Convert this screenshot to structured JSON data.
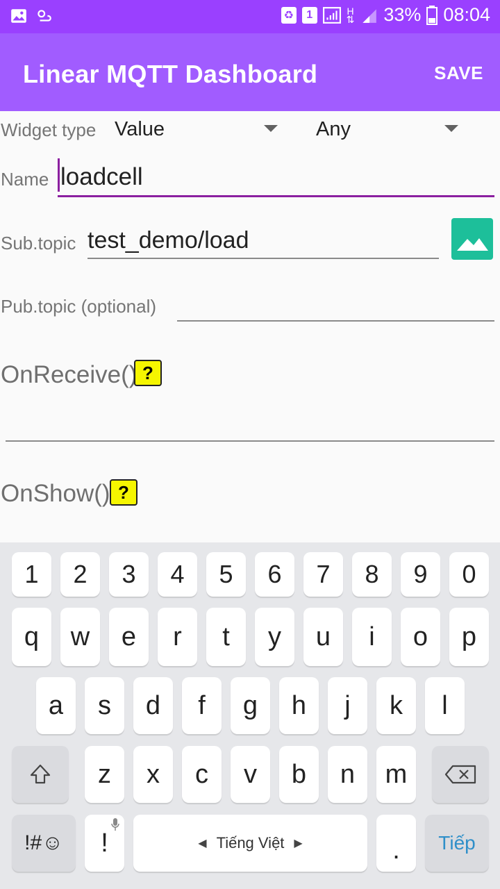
{
  "status_bar": {
    "battery_percent": "33%",
    "time": "08:04",
    "sim_slot": "1",
    "net_type": "H",
    "icons": [
      "image-icon",
      "weather-icon",
      "recycle-icon",
      "sim-icon",
      "signal-icon",
      "data-arrows-icon",
      "signal-icon",
      "battery-icon"
    ]
  },
  "app_bar": {
    "title": "Linear MQTT Dashboard",
    "save_label": "SAVE"
  },
  "form": {
    "widget_type_label": "Widget type",
    "widget_type_value": "Value",
    "second_select_value": "Any",
    "name_label": "Name",
    "name_value": "loadcell",
    "sub_topic_label": "Sub.topic",
    "sub_topic_value": "test_demo/load",
    "pub_topic_placeholder": "Pub.topic (optional)",
    "on_receive_label": "OnReceive()",
    "on_show_label": "OnShow()",
    "help_label": "?"
  },
  "keyboard": {
    "row_numbers": [
      "1",
      "2",
      "3",
      "4",
      "5",
      "6",
      "7",
      "8",
      "9",
      "0"
    ],
    "row_1": [
      "q",
      "w",
      "e",
      "r",
      "t",
      "y",
      "u",
      "i",
      "o",
      "p"
    ],
    "row_2": [
      "a",
      "s",
      "d",
      "f",
      "g",
      "h",
      "j",
      "k",
      "l"
    ],
    "row_3": [
      "z",
      "x",
      "c",
      "v",
      "b",
      "n",
      "m"
    ],
    "symbols_label": "!#☺",
    "excl_label": "!",
    "space_label": "Tiếng Việt",
    "period_label": ".",
    "enter_label": "Tiếp"
  },
  "colors": {
    "status_bar": "#9a40ff",
    "app_bar": "#a15cff",
    "focus_underline": "#8b1fa0",
    "image_button": "#1dbf9a",
    "help_button": "#f5f500",
    "enter_key_text": "#2f8fc9"
  }
}
